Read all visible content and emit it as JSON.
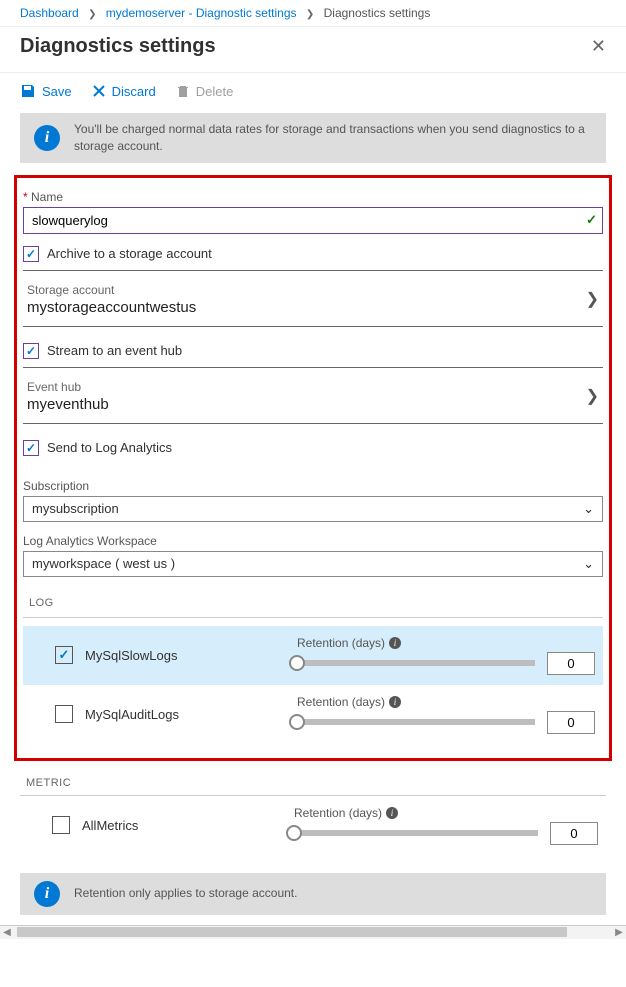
{
  "breadcrumb": {
    "dashboard": "Dashboard",
    "server": "mydemoserver - Diagnostic settings",
    "current": "Diagnostics settings"
  },
  "title": "Diagnostics settings",
  "toolbar": {
    "save": "Save",
    "discard": "Discard",
    "delete": "Delete"
  },
  "info1": "You'll be charged normal data rates for storage and transactions when you send diagnostics to a storage account.",
  "form": {
    "name_label": "Name",
    "name_value": "slowquerylog",
    "archive_label": "Archive to a storage account",
    "storage_label": "Storage account",
    "storage_value": "mystorageaccountwestus",
    "stream_label": "Stream to an event hub",
    "eventhub_label": "Event hub",
    "eventhub_value": "myeventhub",
    "send_la_label": "Send to Log Analytics",
    "subscription_label": "Subscription",
    "subscription_value": "mysubscription",
    "workspace_label": "Log Analytics Workspace",
    "workspace_value": "myworkspace ( west us )"
  },
  "sections": {
    "log": "LOG",
    "metric": "METRIC"
  },
  "retention_label": "Retention (days)",
  "logs": [
    {
      "name": "MySqlSlowLogs",
      "checked": true,
      "days": "0"
    },
    {
      "name": "MySqlAuditLogs",
      "checked": false,
      "days": "0"
    }
  ],
  "metrics": [
    {
      "name": "AllMetrics",
      "checked": false,
      "days": "0"
    }
  ],
  "info2": "Retention only applies to storage account."
}
